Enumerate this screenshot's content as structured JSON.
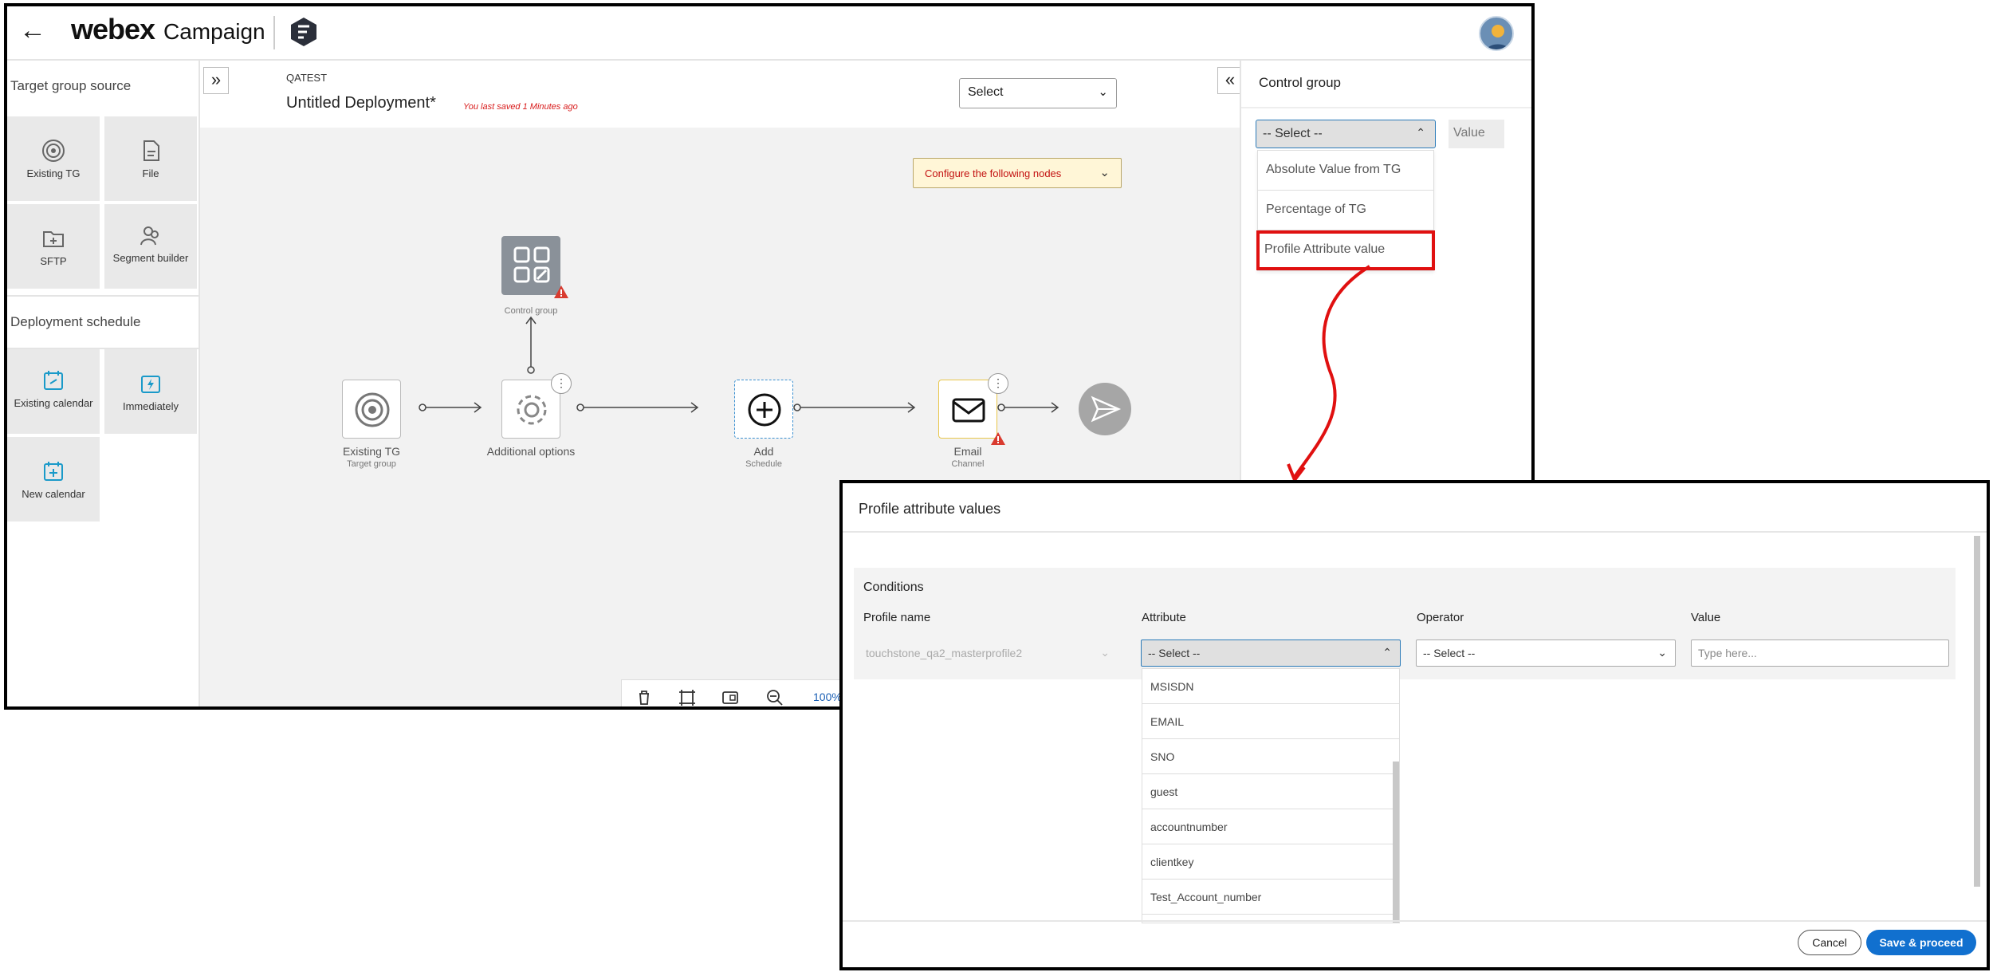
{
  "header": {
    "brand": "webex",
    "product": "Campaign"
  },
  "sidebar": {
    "target_heading": "Target group source",
    "target_tiles": [
      {
        "label": "Existing TG",
        "icon": "target-icon"
      },
      {
        "label": "File",
        "icon": "file-icon"
      },
      {
        "label": "SFTP",
        "icon": "folder-icon"
      },
      {
        "label": "Segment builder",
        "icon": "users-icon"
      }
    ],
    "schedule_heading": "Deployment schedule",
    "schedule_tiles": [
      {
        "label": "Existing calendar",
        "icon": "calendar-link-icon"
      },
      {
        "label": "Immediately",
        "icon": "lightning-icon"
      },
      {
        "label": "New calendar",
        "icon": "calendar-plus-icon"
      }
    ]
  },
  "canvas": {
    "org": "QATEST",
    "title": "Untitled Deployment*",
    "saved_note": "You last saved 1 Minutes ago",
    "top_select": "Select",
    "config_banner": "Configure the following nodes",
    "nodes": {
      "control": {
        "label": "Control group"
      },
      "existing": {
        "label": "Existing TG",
        "sub": "Target group"
      },
      "additional": {
        "label": "Additional options"
      },
      "add": {
        "label": "Add",
        "sub": "Schedule"
      },
      "email": {
        "label": "Email",
        "sub": "Channel"
      }
    },
    "zoom": "100%"
  },
  "right_panel": {
    "title": "Control group",
    "select_value": "-- Select --",
    "value_placeholder": "Value",
    "options": [
      "Absolute Value from TG",
      "Percentage of TG",
      "Profile Attribute value"
    ]
  },
  "modal": {
    "title": "Profile attribute values",
    "conditions_label": "Conditions",
    "columns": {
      "profile": "Profile name",
      "attribute": "Attribute",
      "operator": "Operator",
      "value": "Value"
    },
    "profile_value": "touchstone_qa2_masterprofile2",
    "attribute_value": "-- Select --",
    "operator_value": "-- Select --",
    "value_placeholder": "Type here...",
    "attribute_options": [
      "MSISDN",
      "EMAIL",
      "SNO",
      "guest",
      "accountnumber",
      "clientkey",
      "Test_Account_number"
    ],
    "cancel_label": "Cancel",
    "save_label": "Save & proceed"
  },
  "colors": {
    "accent": "#1170cf",
    "highlight": "#e01010",
    "warning": "#c31111"
  }
}
